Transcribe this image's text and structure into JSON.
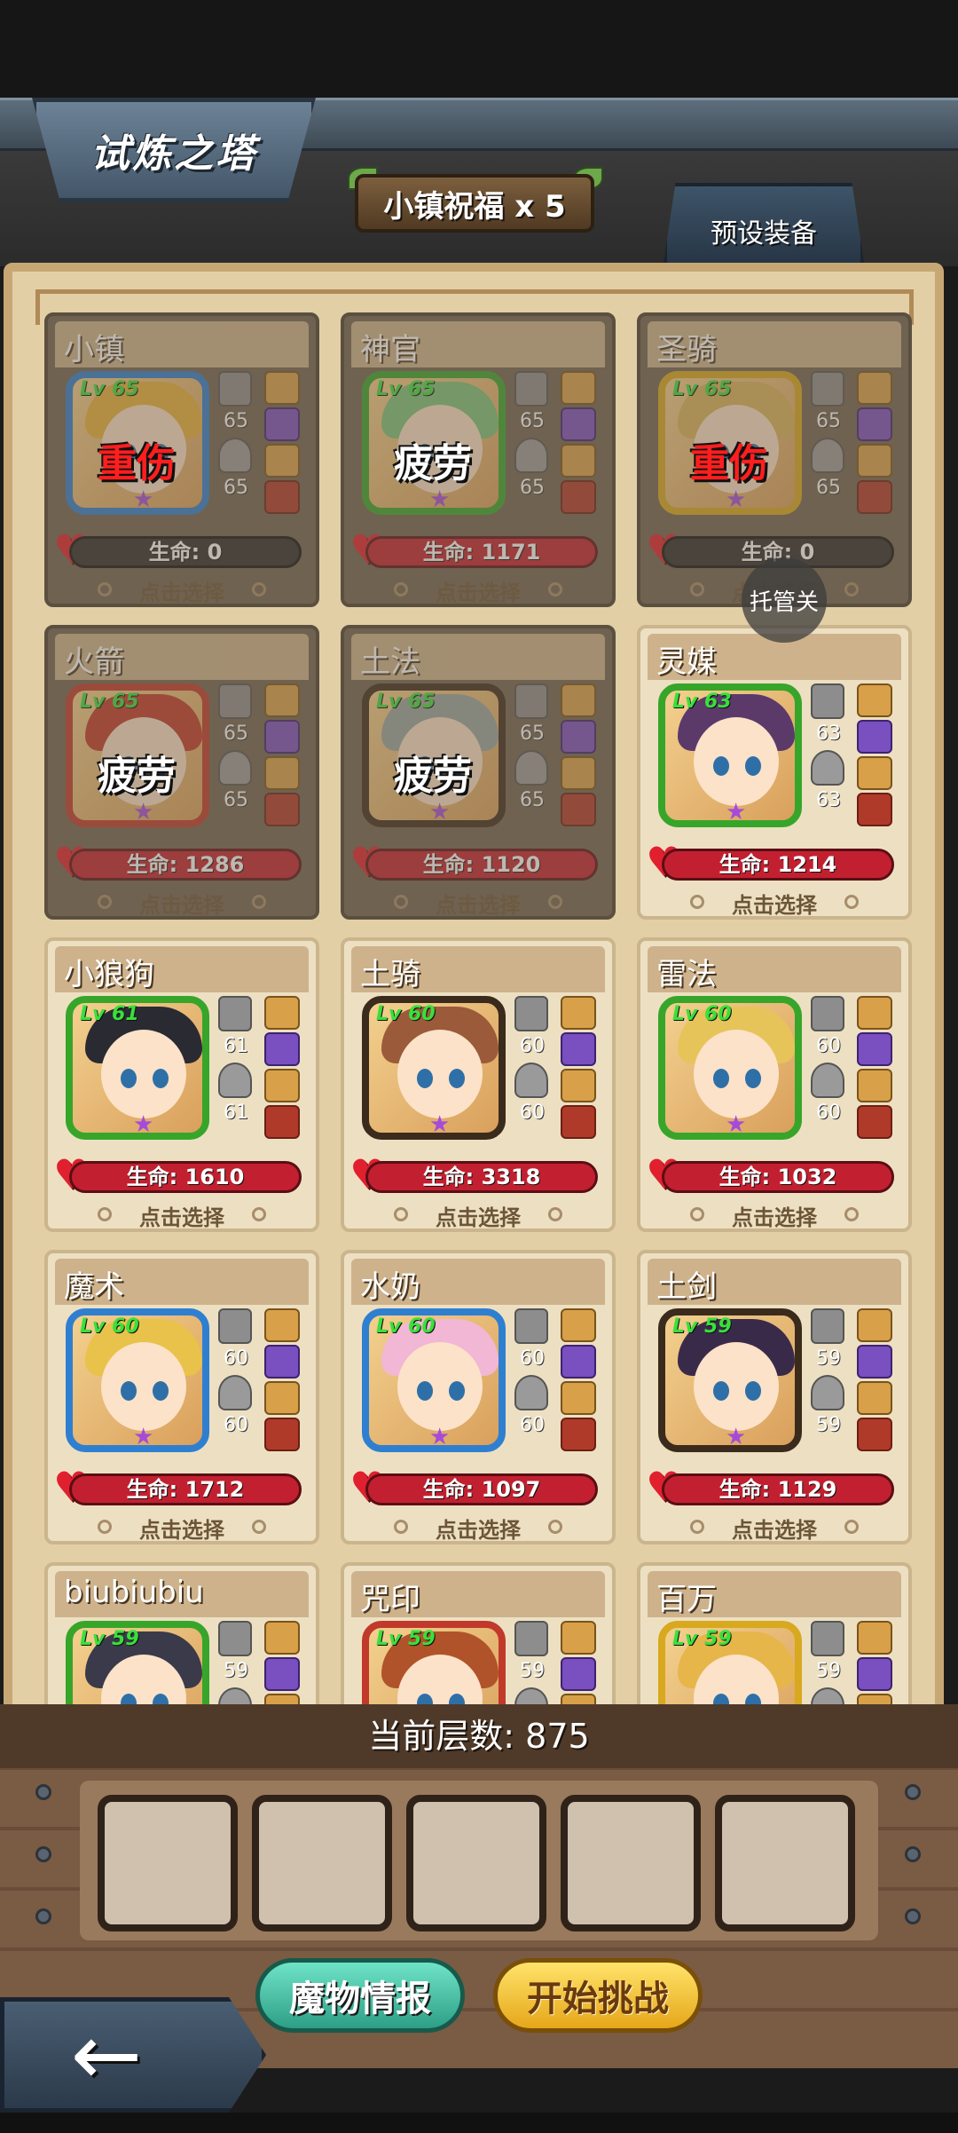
{
  "header": {
    "title": "试炼之塔",
    "buff_label": "小镇祝福 x 5",
    "preset_equipment_label": "预设装备"
  },
  "auto_button_label": "托管关",
  "heroes": [
    {
      "name": "小镇",
      "level": "Lv 65",
      "status": "重伤",
      "hp": "生命: 0",
      "atk": "65",
      "def": "65",
      "frame": "blue",
      "dim": true
    },
    {
      "name": "神官",
      "level": "Lv 65",
      "status": "疲劳",
      "hp": "生命: 1171",
      "atk": "65",
      "def": "65",
      "frame": "green",
      "dim": true
    },
    {
      "name": "圣骑",
      "level": "Lv 65",
      "status": "重伤",
      "hp": "生命: 0",
      "atk": "65",
      "def": "65",
      "frame": "yellow",
      "dim": true
    },
    {
      "name": "火箭",
      "level": "Lv 65",
      "status": "疲劳",
      "hp": "生命: 1286",
      "atk": "65",
      "def": "65",
      "frame": "red",
      "dim": true
    },
    {
      "name": "土法",
      "level": "Lv 65",
      "status": "疲劳",
      "hp": "生命: 1120",
      "atk": "65",
      "def": "65",
      "frame": "brown",
      "dim": true
    },
    {
      "name": "灵媒",
      "level": "Lv 63",
      "status": "",
      "hp": "生命: 1214",
      "atk": "63",
      "def": "63",
      "frame": "green",
      "dim": false
    },
    {
      "name": "小狼狗",
      "level": "Lv 61",
      "status": "",
      "hp": "生命: 1610",
      "atk": "61",
      "def": "61",
      "frame": "green",
      "dim": false
    },
    {
      "name": "土骑",
      "level": "Lv 60",
      "status": "",
      "hp": "生命: 3318",
      "atk": "60",
      "def": "60",
      "frame": "brown",
      "dim": false
    },
    {
      "name": "雷法",
      "level": "Lv 60",
      "status": "",
      "hp": "生命: 1032",
      "atk": "60",
      "def": "60",
      "frame": "green",
      "dim": false
    },
    {
      "name": "魔术",
      "level": "Lv 60",
      "status": "",
      "hp": "生命: 1712",
      "atk": "60",
      "def": "60",
      "frame": "blue",
      "dim": false
    },
    {
      "name": "水奶",
      "level": "Lv 60",
      "status": "",
      "hp": "生命: 1097",
      "atk": "60",
      "def": "60",
      "frame": "blue",
      "dim": false
    },
    {
      "name": "土剑",
      "level": "Lv 59",
      "status": "",
      "hp": "生命: 1129",
      "atk": "59",
      "def": "59",
      "frame": "brown",
      "dim": false
    },
    {
      "name": "biubiubiu",
      "level": "Lv 59",
      "status": "",
      "hp": "",
      "atk": "59",
      "def": "",
      "frame": "green",
      "dim": false
    },
    {
      "name": "咒印",
      "level": "Lv 59",
      "status": "",
      "hp": "",
      "atk": "59",
      "def": "",
      "frame": "red",
      "dim": false
    },
    {
      "name": "百万",
      "level": "Lv 59",
      "status": "",
      "hp": "",
      "atk": "59",
      "def": "",
      "frame": "yellow",
      "dim": false
    }
  ],
  "select_label": "点击选择",
  "bottom": {
    "floor_label": "当前层数: 875",
    "slot_count": 5,
    "monster_info_label": "魔物情报",
    "start_label": "开始挑战",
    "back_icon": "←"
  }
}
